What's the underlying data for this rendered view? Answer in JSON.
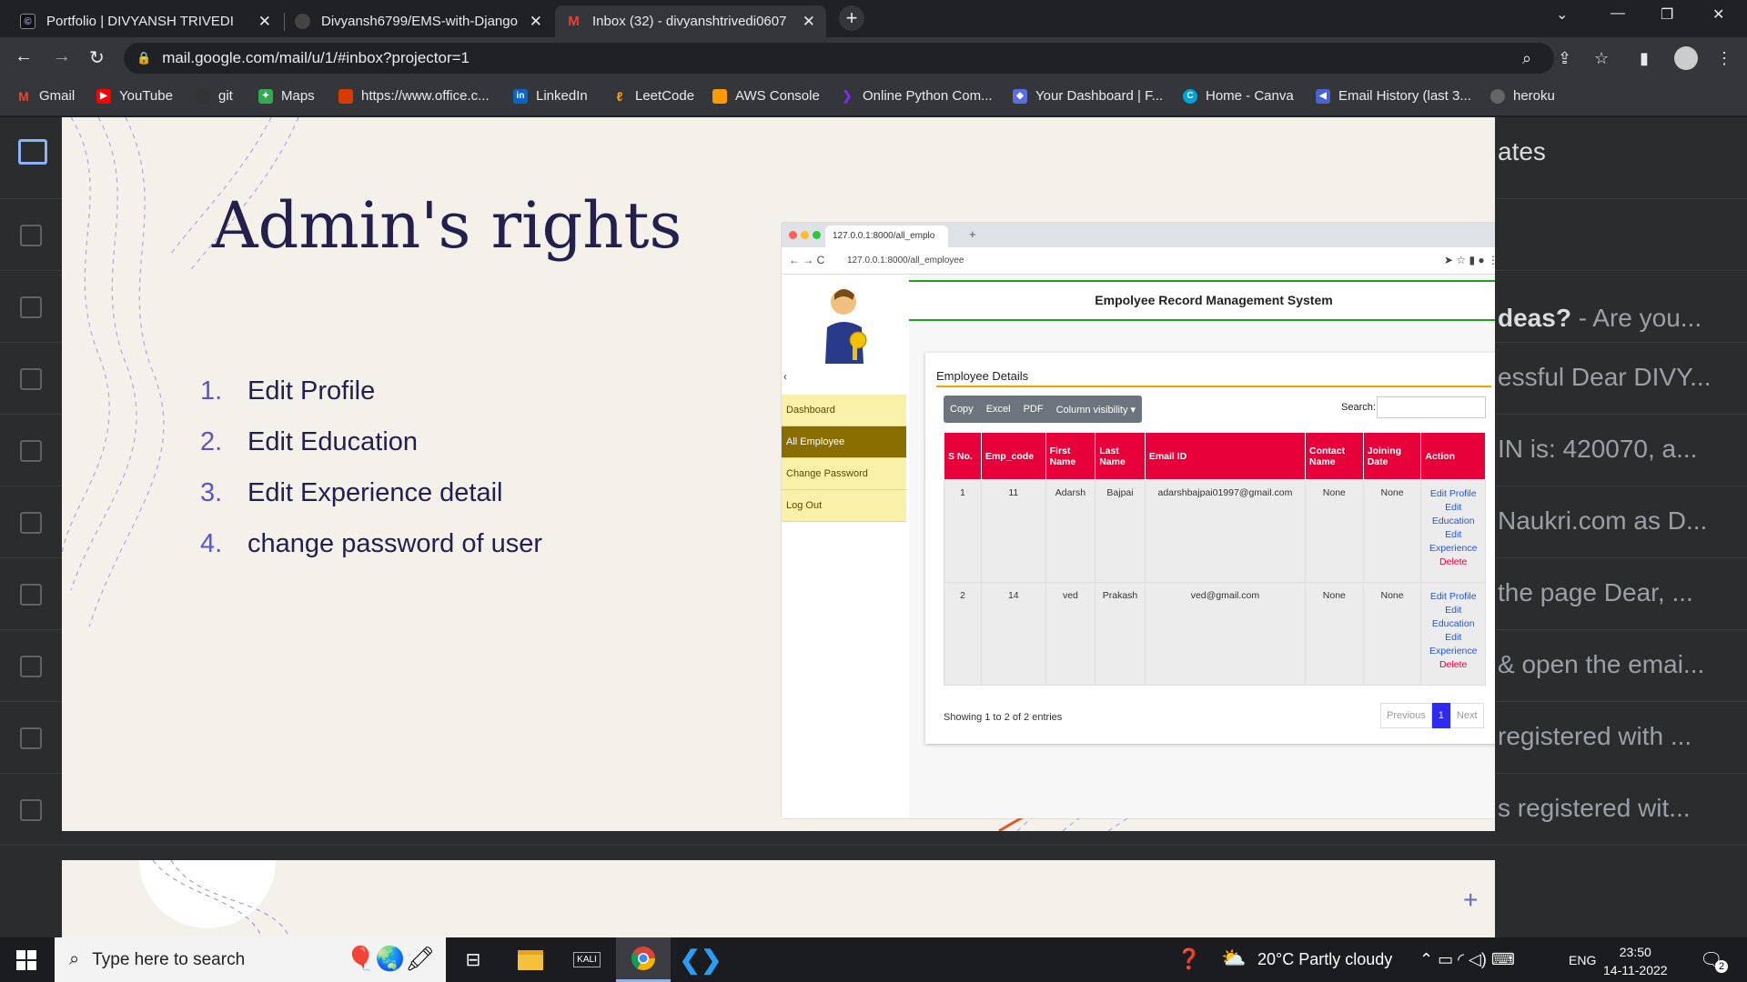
{
  "browser": {
    "tabs": [
      {
        "title": "Portfolio | DIVYANSH TRIVEDI",
        "active": false
      },
      {
        "title": "Divyansh6799/EMS-with-Django",
        "active": false
      },
      {
        "title": "Inbox (32) - divyanshtrivedi0607",
        "active": true
      }
    ],
    "url": "mail.google.com/mail/u/1/#inbox?projector=1",
    "bookmarks": [
      "Gmail",
      "YouTube",
      "git",
      "Maps",
      "https://www.office.c...",
      "LinkedIn",
      "LeetCode",
      "AWS Console",
      "Online Python Com...",
      "Your Dashboard | F...",
      "Home - Canva",
      "Email History (last 3...",
      "heroku"
    ]
  },
  "background_mail": {
    "header_fragment": "ates",
    "snippets": [
      {
        "bold": "deas?",
        "rest": " - Are you..."
      },
      {
        "bold": "",
        "rest": "essful Dear DIVY..."
      },
      {
        "bold": "",
        "rest": "IN is: 420070, a..."
      },
      {
        "bold": "",
        "rest": "Naukri.com as D..."
      },
      {
        "bold": "",
        "rest": "the page Dear, ..."
      },
      {
        "bold": "",
        "rest": "& open the emai..."
      },
      {
        "bold": "",
        "rest": "registered with ..."
      },
      {
        "bold": "",
        "rest": "s registered wit..."
      }
    ]
  },
  "slide": {
    "title": "Admin's rights",
    "items": [
      {
        "num": "1.",
        "text": "Edit Profile"
      },
      {
        "num": "2.",
        "text": "Edit Education"
      },
      {
        "num": "3.",
        "text": "Edit Experience detail"
      },
      {
        "num": "4.",
        "text": "change password of user"
      }
    ]
  },
  "embedded": {
    "tab_title": "127.0.0.1:8000/all_emplo",
    "url": "127.0.0.1:8000/all_employee",
    "header": "Empolyee Record Management System",
    "menu": [
      "Dashboard",
      "All Employee",
      "Change Password",
      "Log Out"
    ],
    "active_menu": "All Employee",
    "card_title": "Employee Details",
    "buttons": [
      "Copy",
      "Excel",
      "PDF",
      "Column visibility ▾"
    ],
    "search_label": "Search:",
    "columns": [
      "S No.",
      "Emp_code",
      "First Name",
      "Last Name",
      "Email ID",
      "Contact Name",
      "Joining Date",
      "Action"
    ],
    "rows": [
      {
        "sno": "1",
        "code": "11",
        "first": "Adarsh",
        "last": "Bajpai",
        "email": "adarshbajpai01997@gmail.com",
        "contact": "None",
        "joining": "None"
      },
      {
        "sno": "2",
        "code": "14",
        "first": "ved",
        "last": "Prakash",
        "email": "ved@gmail.com",
        "contact": "None",
        "joining": "None"
      }
    ],
    "actions": {
      "edit_profile": "Edit Profile",
      "edit_education": "Edit Education",
      "edit_experience": "Edit Experience",
      "delete": "Delete"
    },
    "info": "Showing 1 to 2 of 2 entries",
    "pager": {
      "prev": "Previous",
      "current": "1",
      "next": "Next"
    }
  },
  "taskbar": {
    "search_placeholder": "Type here to search",
    "weather": "20°C  Partly cloudy",
    "lang": "ENG",
    "time": "23:50",
    "date": "14-11-2022",
    "notifications": "2"
  },
  "colors": {
    "accent": "#5d55c6",
    "slide_bg": "#f4f0ea",
    "table_header": "#e8003a",
    "menu_active": "#8a6d00"
  }
}
